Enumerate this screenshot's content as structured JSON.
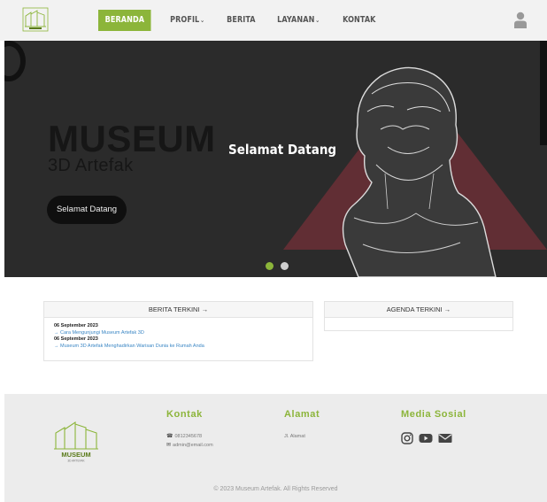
{
  "nav": {
    "items": [
      {
        "label": "BERANDA",
        "active": true
      },
      {
        "label": "PROFIL",
        "dropdown": true
      },
      {
        "label": "BERITA"
      },
      {
        "label": "LAYANAN",
        "dropdown": true
      },
      {
        "label": "KONTAK"
      }
    ],
    "accent": "#8cb53a"
  },
  "hero": {
    "title": "MUSEUM",
    "subtitle": "3D Artefak",
    "button_label": "Selamat Datang",
    "caption": "Selamat Datang",
    "slide_count": 2,
    "active_slide": 1
  },
  "news": {
    "header": "BERITA TERKINI →",
    "items": [
      {
        "date": "06 September 2023",
        "title": "→ Cara Mengunjungi Museum Artefak 3D"
      },
      {
        "date": "06 September 2023",
        "title": "→ Museum 3D Artefak Menghadirkan Warisan Dunia ke Rumah Anda"
      }
    ]
  },
  "agenda": {
    "header": "AGENDA TERKINI →"
  },
  "footer": {
    "logo_text": "MUSEUM",
    "logo_sub": "3D ARTEFAK",
    "kontak": {
      "title": "Kontak",
      "phone": "0812345678",
      "email": "admin@email.com"
    },
    "alamat": {
      "title": "Alamat",
      "address": "Jl. Alamat"
    },
    "sosial": {
      "title": "Media Sosial",
      "icons": [
        "instagram-icon",
        "youtube-icon",
        "mail-icon"
      ]
    },
    "copyright": "© 2023 Museum Artefak. All Rights Reserved"
  }
}
